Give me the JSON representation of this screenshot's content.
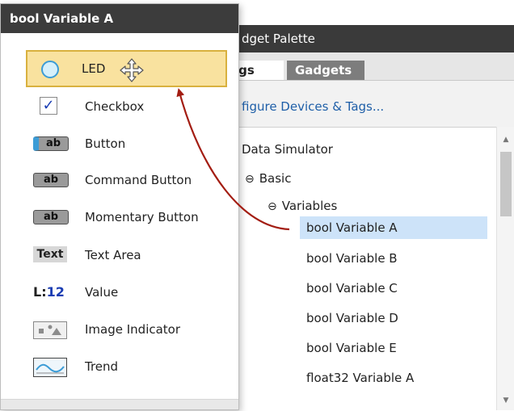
{
  "palette": {
    "title": "dget Palette",
    "tabs": [
      {
        "label": "ags"
      },
      {
        "label": "Gadgets"
      }
    ],
    "configure_link": "figure Devices & Tags...",
    "tree": [
      {
        "label": "Data Simulator"
      },
      {
        "label": "Basic",
        "toggle": "⊖"
      },
      {
        "label": "Variables",
        "toggle": "⊖"
      },
      {
        "label": "bool Variable A",
        "selected": true
      },
      {
        "label": "bool Variable B"
      },
      {
        "label": "bool Variable C"
      },
      {
        "label": "bool Variable D"
      },
      {
        "label": "bool Variable E"
      },
      {
        "label": "float32 Variable A"
      }
    ],
    "scroll_up": "▲",
    "scroll_down": "▼"
  },
  "popup": {
    "title": "bool Variable A",
    "gadgets": [
      {
        "label": "LED",
        "icon": "led-icon"
      },
      {
        "label": "Checkbox",
        "icon": "checkbox-icon",
        "glyph": "✓"
      },
      {
        "label": "Button",
        "icon": "button-icon",
        "glyph": "ab"
      },
      {
        "label": "Command Button",
        "icon": "command-button-icon",
        "glyph": "ab"
      },
      {
        "label": "Momentary Button",
        "icon": "momentary-button-icon",
        "glyph": "ab"
      },
      {
        "label": "Text Area",
        "icon": "text-area-icon",
        "glyph": "Text"
      },
      {
        "label": "Value",
        "icon": "value-icon",
        "glyph_prefix": "L:",
        "glyph_num": "12"
      },
      {
        "label": "Image Indicator",
        "icon": "image-indicator-icon"
      },
      {
        "label": "Trend",
        "icon": "trend-icon"
      }
    ]
  },
  "colors": {
    "selected_gadget_bg": "#f9e29f",
    "selected_gadget_border": "#d9b13e",
    "tree_selection": "#cde3f9",
    "drag_arrow": "#a31d12",
    "title_bar": "#3c3c3c",
    "link": "#1f5fa8"
  }
}
